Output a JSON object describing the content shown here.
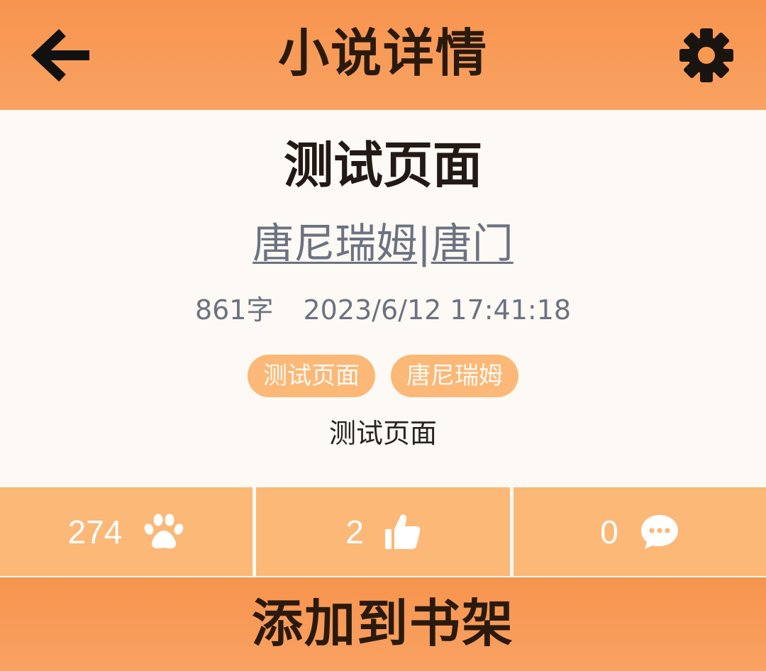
{
  "appbar": {
    "title": "小说详情",
    "back_icon": "arrow-left-icon",
    "settings_icon": "gear-icon",
    "background": "#f7944e"
  },
  "novel": {
    "title": "测试页面",
    "author": "唐尼瑞姆",
    "separator": "|",
    "faction": "唐门",
    "word_count": "861字",
    "updated_at": "2023/6/12 17:41:18",
    "tags": [
      "测试页面",
      "唐尼瑞姆"
    ],
    "description": "测试页面"
  },
  "stats": {
    "views": {
      "value": "274",
      "icon": "paw-icon"
    },
    "likes": {
      "value": "2",
      "icon": "thumbs-up-icon"
    },
    "comments": {
      "value": "0",
      "icon": "comment-bubble-icon"
    }
  },
  "actions": {
    "add_to_shelf": "添加到书架"
  },
  "colors": {
    "accent": "#f7944e",
    "tag_bg": "#fbb877",
    "stat_bg": "#fbb877",
    "muted_text": "#6b7280",
    "page_bg": "#fdf9f4"
  }
}
